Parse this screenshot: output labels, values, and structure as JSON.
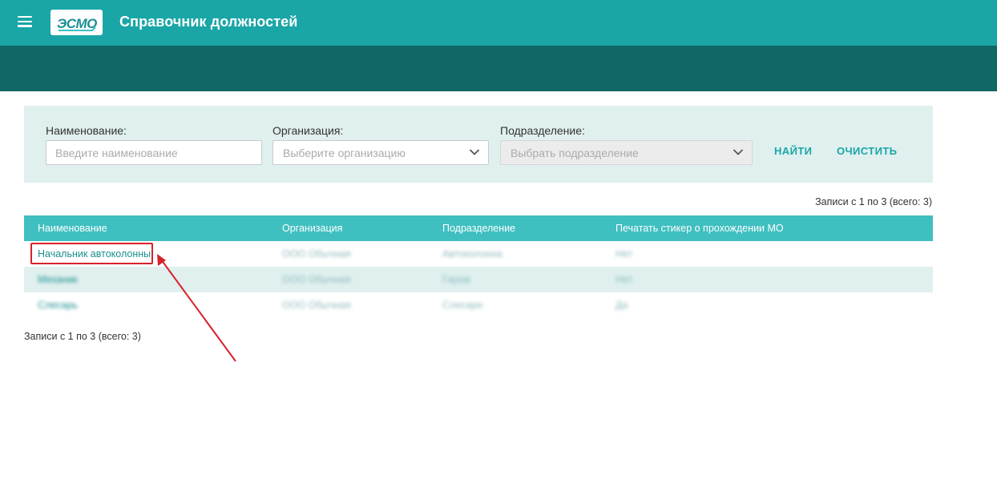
{
  "header": {
    "app_title": "Справочник должностей",
    "logo_text": "ЭСМО",
    "colors": {
      "primary": "#1aa6a6",
      "dark": "#106766",
      "accent_red": "#d7222b"
    }
  },
  "filters": {
    "name_label": "Наименование:",
    "name_placeholder": "Введите наименование",
    "org_label": "Организация:",
    "org_placeholder": "Выберите организацию",
    "dept_label": "Подразделение:",
    "dept_placeholder": "Выбрать подразделение",
    "find_button": "НАЙТИ",
    "clear_button": "ОЧИСТИТЬ"
  },
  "records_info": "Записи с 1 по 3 (всего: 3)",
  "table": {
    "columns": [
      "Наименование",
      "Организация",
      "Подразделение",
      "Печатать стикер о прохождении МО"
    ],
    "rows": [
      {
        "name": "Начальник автоколонны",
        "org": "ООО Обычная",
        "dept": "Автоколонна",
        "print": "Нет"
      },
      {
        "name": "Механик",
        "org": "ООО Обычная",
        "dept": "Гараж",
        "print": "Нет"
      },
      {
        "name": "Слесарь",
        "org": "ООО Обычная",
        "dept": "Слесарн",
        "print": "Да"
      }
    ]
  }
}
